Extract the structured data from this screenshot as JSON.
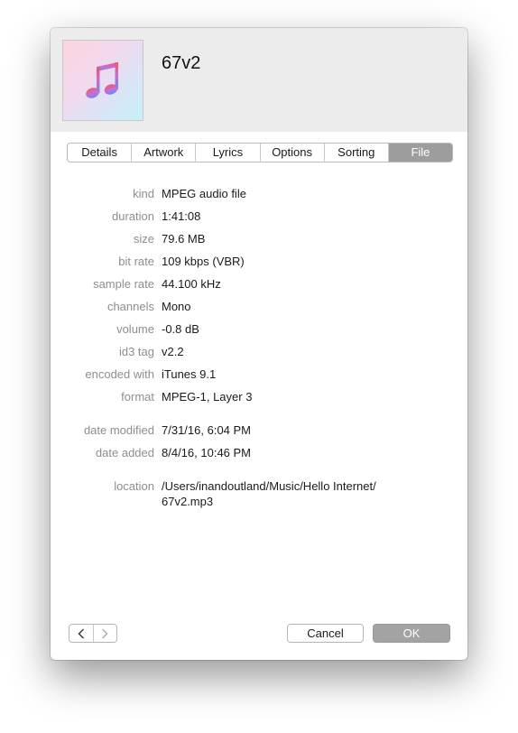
{
  "track": {
    "title": "67v2"
  },
  "icons": {
    "artwork": "music-note-icon",
    "prev": "chevron-left-icon",
    "next": "chevron-right-icon"
  },
  "colors": {
    "active_tab": "#9d9d9d",
    "label": "#8e8e8e",
    "ok_button": "#a3a3a3"
  },
  "tabs": [
    {
      "label": "Details",
      "active": false
    },
    {
      "label": "Artwork",
      "active": false
    },
    {
      "label": "Lyrics",
      "active": false
    },
    {
      "label": "Options",
      "active": false
    },
    {
      "label": "Sorting",
      "active": false
    },
    {
      "label": "File",
      "active": true
    }
  ],
  "file_info": {
    "kind": {
      "label": "kind",
      "value": "MPEG audio file"
    },
    "duration": {
      "label": "duration",
      "value": "1:41:08"
    },
    "size": {
      "label": "size",
      "value": "79.6 MB"
    },
    "bit_rate": {
      "label": "bit rate",
      "value": "109 kbps (VBR)"
    },
    "sample_rate": {
      "label": "sample rate",
      "value": "44.100 kHz"
    },
    "channels": {
      "label": "channels",
      "value": "Mono"
    },
    "volume": {
      "label": "volume",
      "value": "-0.8 dB"
    },
    "id3_tag": {
      "label": "id3 tag",
      "value": "v2.2"
    },
    "encoded_with": {
      "label": "encoded with",
      "value": "iTunes 9.1"
    },
    "format": {
      "label": "format",
      "value": "MPEG-1, Layer 3"
    },
    "date_modified": {
      "label": "date modified",
      "value": "7/31/16, 6:04 PM"
    },
    "date_added": {
      "label": "date added",
      "value": "8/4/16, 10:46 PM"
    },
    "location": {
      "label": "location",
      "value": "/Users/inandoutland/Music/Hello Internet/\n67v2.mp3"
    }
  },
  "buttons": {
    "cancel": "Cancel",
    "ok": "OK"
  }
}
